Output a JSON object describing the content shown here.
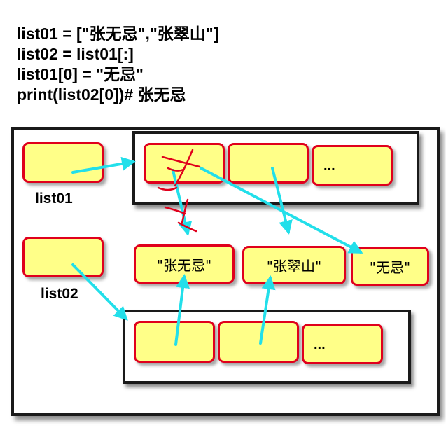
{
  "code": {
    "line1": "list01 = [\"张无忌\",\"张翠山\"]",
    "line2": "list02 = list01[:]",
    "line3": "list01[0] = \"无忌\"",
    "line4": "print(list02[0])# 张无忌"
  },
  "labels": {
    "list01": "list01",
    "list02": "list02"
  },
  "list01_cells": {
    "cell3": "..."
  },
  "list02_cells": {
    "cell3": "..."
  },
  "strings": {
    "s1": "\"张无忌\"",
    "s2": "\"张翠山\"",
    "s3": "\"无忌\""
  },
  "colors": {
    "cell_fill": "#ffff88",
    "cell_border": "#e0001c",
    "arrow": "#22dfea",
    "strike": "#e0001c"
  }
}
